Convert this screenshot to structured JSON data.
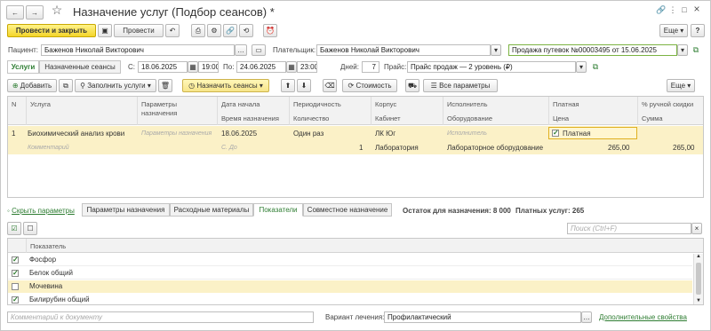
{
  "titlebar": {
    "back": "←",
    "fwd": "→",
    "star": "☆",
    "title": "Назначение услуг (Подбор сеансов) *",
    "link_icon": "🔗",
    "more": "⋮",
    "max": "□",
    "close": "×"
  },
  "toolbar": {
    "post_close": "Провести и закрыть",
    "post": "Провести",
    "more": "Еще",
    "help": "?"
  },
  "patient": {
    "label": "Пациент:",
    "value": "Баженов Николай Викторович",
    "payer_label": "Плательщик:",
    "payer_value": "Баженов Николай Викторович",
    "voucher": "Продажа путевок №00003495 от 15.06.2025"
  },
  "period": {
    "tab_services": "Услуги",
    "tab_assigned": "Назначенные сеансы",
    "from_label": "С:",
    "from_date": "18.06.2025",
    "from_time": "19:00",
    "to_label": "По:",
    "to_date": "24.06.2025",
    "to_time": "23:00",
    "days_label": "Дней:",
    "days": "7",
    "price_label": "Прайс:",
    "price_value": "Прайс продаж — 2 уровень (₽)"
  },
  "actions": {
    "add": "Добавить",
    "fill": "Заполнить услуги",
    "assign": "Назначить сеансы",
    "cost": "Стоимость",
    "all_params": "Все параметры",
    "more": "Еще"
  },
  "table": {
    "h1": {
      "n": "N",
      "service": "Услуга",
      "params": "Параметры назначения",
      "start": "Дата начала",
      "period": "Периодичность",
      "building": "Корпус",
      "executor": "Исполнитель",
      "paid": "Платная",
      "manual_disc": "% ручной скидки"
    },
    "h2": {
      "time": "Время назначения",
      "qty": "Количество",
      "room": "Кабинет",
      "equipment": "Оборудование",
      "price": "Цена",
      "sum": "Сумма"
    },
    "row": {
      "n": "1",
      "service": "Биохимический анализ крови",
      "params": "Параметры назначения",
      "start": "18.06.2025",
      "period": "Один раз",
      "building": "ЛК Юг",
      "executor": "Исполнитель",
      "paid": "Платная",
      "comment": "Комментарий",
      "time": "С. До",
      "qty": "1",
      "room": "Лаборатория",
      "equipment": "Лабораторное оборудование",
      "price": "265,00",
      "sum": "265,00"
    }
  },
  "bottom_tabs": {
    "hide": "Скрыть параметры",
    "t1": "Параметры назначения",
    "t2": "Расходные материалы",
    "t3": "Показатели",
    "t4": "Совместное назначение",
    "remaining": "Остаток для назначения: 8 000",
    "paid": "Платных услуг: 265"
  },
  "indicators": {
    "search_ph": "Поиск (Ctrl+F)",
    "col": "Показатель",
    "items": [
      "Фосфор",
      "Белок общий",
      "Мочевина",
      "Билирубин общий"
    ]
  },
  "footer": {
    "comment_ph": "Комментарий к документу",
    "variant_label": "Вариант лечения:",
    "variant": "Профилактический",
    "extra": "Дополнительные свойства"
  }
}
